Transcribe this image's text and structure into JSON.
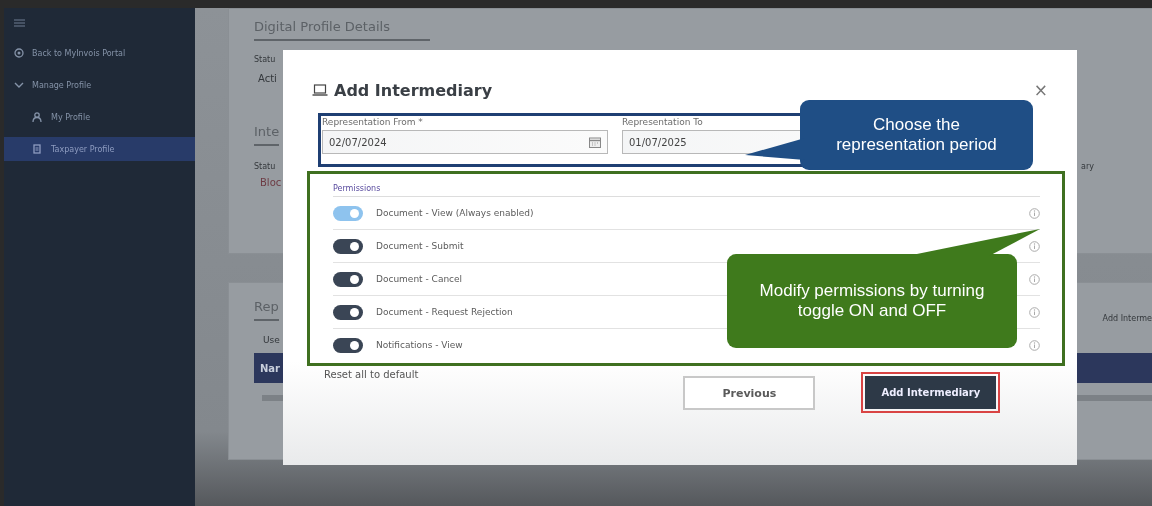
{
  "sidebar": {
    "items": [
      {
        "kind": "link",
        "label": "Back to MyInvois Portal",
        "selected": false
      },
      {
        "kind": "group",
        "label": "Manage Profile",
        "expanded": true,
        "selected": false,
        "children": [
          {
            "kind": "person",
            "label": "My Profile",
            "selected": false
          },
          {
            "kind": "document",
            "label": "Taxpayer Profile",
            "selected": true
          }
        ]
      }
    ]
  },
  "backdrop": {
    "profile_heading": "Digital Profile Details",
    "status_label": "Statu",
    "status_value": "Acti",
    "intermediary_heading": "Inte",
    "intermediary_status_label": "Statu",
    "intermediary_status_value": "Bloc",
    "intermediary_column_4": "ary",
    "representatives_heading": "Rep",
    "add_link": "Add Interme",
    "users_label": "Use",
    "table_header": "Nar"
  },
  "dialog": {
    "title": "Add Intermediary",
    "close_icon": "×",
    "fields": [
      {
        "label": "Representation From *",
        "value": "02/07/2024",
        "kind": "date"
      },
      {
        "label": "Representation To",
        "value": "01/07/2025",
        "kind": "text"
      }
    ],
    "permissions_title": "Permissions",
    "permissions": [
      {
        "label": "Document - View (Always enabled)",
        "on": true,
        "disabled": true
      },
      {
        "label": "Document - Submit",
        "on": true,
        "disabled": false
      },
      {
        "label": "Document - Cancel",
        "on": true,
        "disabled": false
      },
      {
        "label": "Document - Request Rejection",
        "on": true,
        "disabled": false
      },
      {
        "label": "Notifications - View",
        "on": true,
        "disabled": false
      }
    ],
    "reset_link": "Reset all to default",
    "buttons": [
      {
        "label": "Previous",
        "kind": "secondary"
      },
      {
        "label": "Add Intermediary",
        "kind": "primary"
      }
    ]
  },
  "callouts": [
    {
      "text": "Choose the representation period",
      "color": "#1f4e85"
    },
    {
      "text": "Modify permissions by turning toggle ON and OFF",
      "color": "#3f7a1c"
    }
  ]
}
